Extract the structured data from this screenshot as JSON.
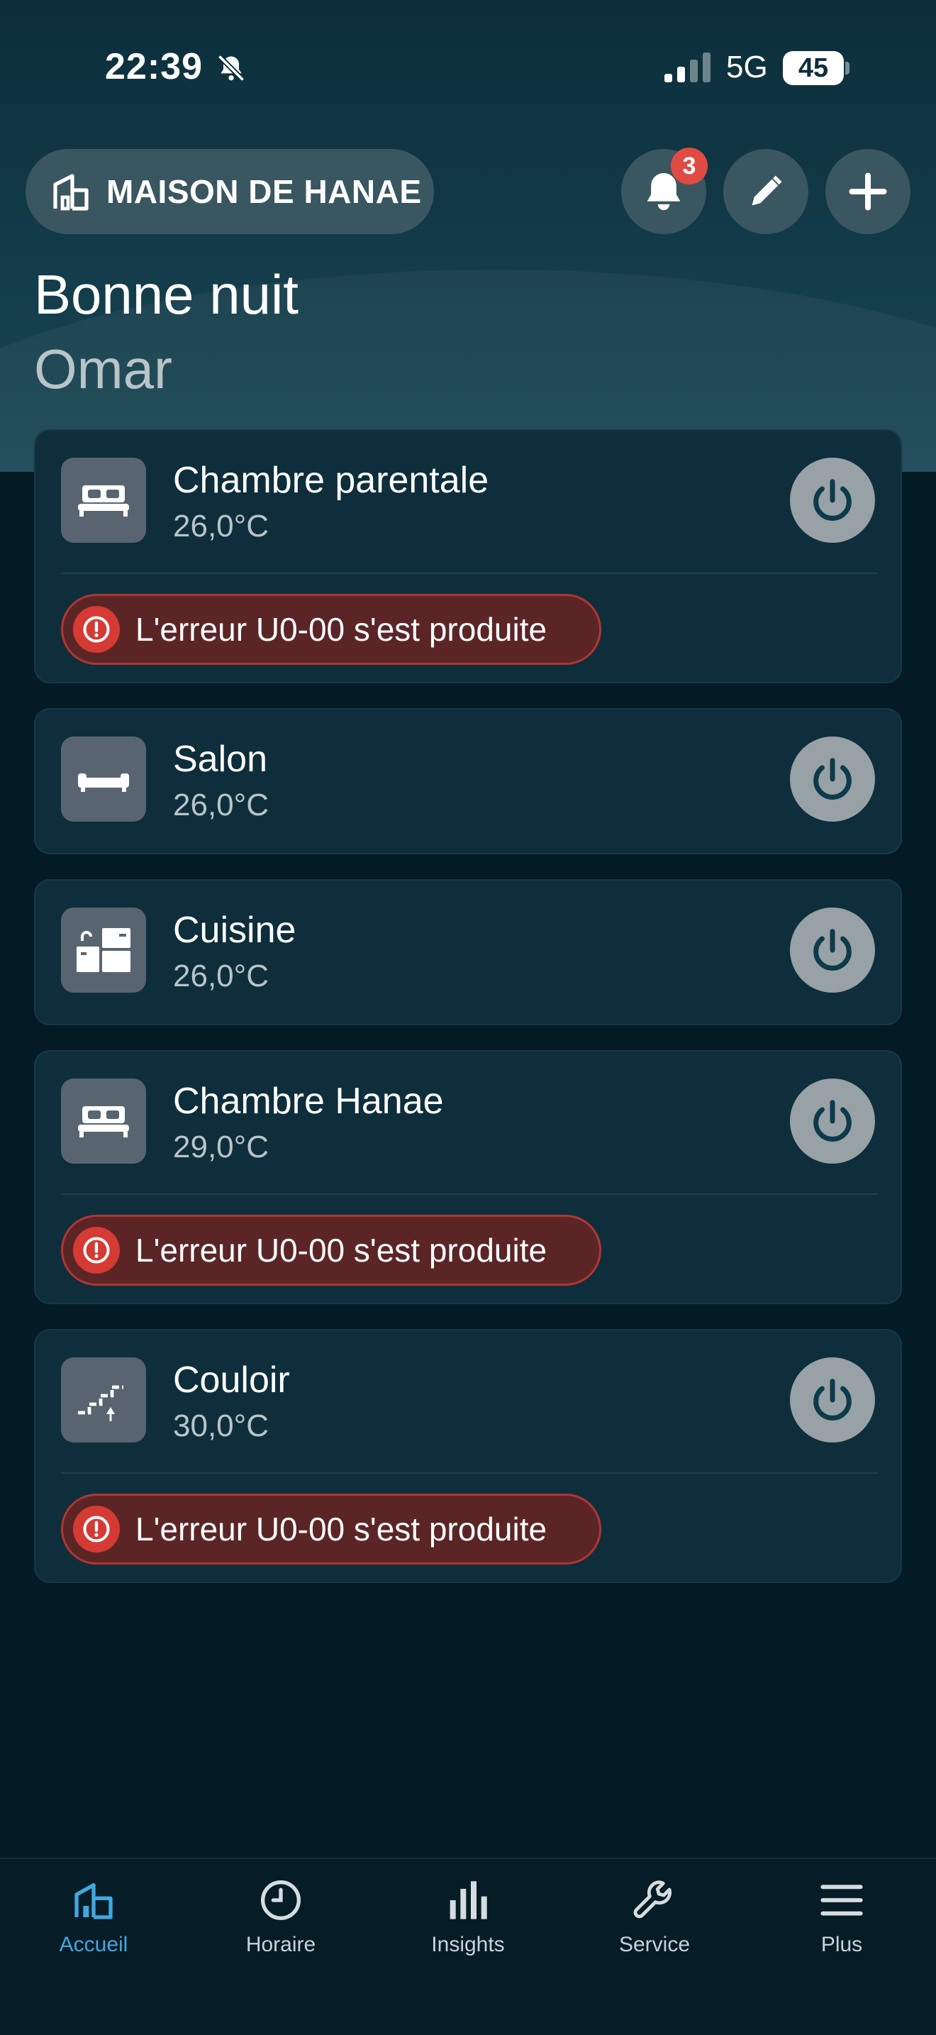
{
  "status_bar": {
    "time": "22:39",
    "network": "5G",
    "battery": "45"
  },
  "header": {
    "home_name": "MAISON DE HANAE",
    "notification_count": "3",
    "greeting": "Bonne nuit",
    "user_name": "Omar"
  },
  "rooms": [
    {
      "name": "Chambre parentale",
      "temp": "26,0°C",
      "icon": "bed-icon",
      "error": "L'erreur U0-00 s'est produite"
    },
    {
      "name": "Salon",
      "temp": "26,0°C",
      "icon": "sofa-icon",
      "error": ""
    },
    {
      "name": "Cuisine",
      "temp": "26,0°C",
      "icon": "kitchen-icon",
      "error": ""
    },
    {
      "name": "Chambre Hanae",
      "temp": "29,0°C",
      "icon": "bed-icon",
      "error": "L'erreur U0-00 s'est produite"
    },
    {
      "name": "Couloir",
      "temp": "30,0°C",
      "icon": "stairs-icon",
      "error": "L'erreur U0-00 s'est produite"
    }
  ],
  "nav": {
    "items": [
      {
        "label": "Accueil",
        "icon": "home-icon",
        "active": true
      },
      {
        "label": "Horaire",
        "icon": "clock-icon",
        "active": false
      },
      {
        "label": "Insights",
        "icon": "bar-chart-icon",
        "active": false
      },
      {
        "label": "Service",
        "icon": "wrench-icon",
        "active": false
      },
      {
        "label": "Plus",
        "icon": "menu-icon",
        "active": false
      }
    ]
  },
  "colors": {
    "accent": "#3fa9e0",
    "error_bg": "#5b2526",
    "error_icon": "#d53a34",
    "card_bg": "#0e2e3b",
    "badge": "#e04b43"
  }
}
